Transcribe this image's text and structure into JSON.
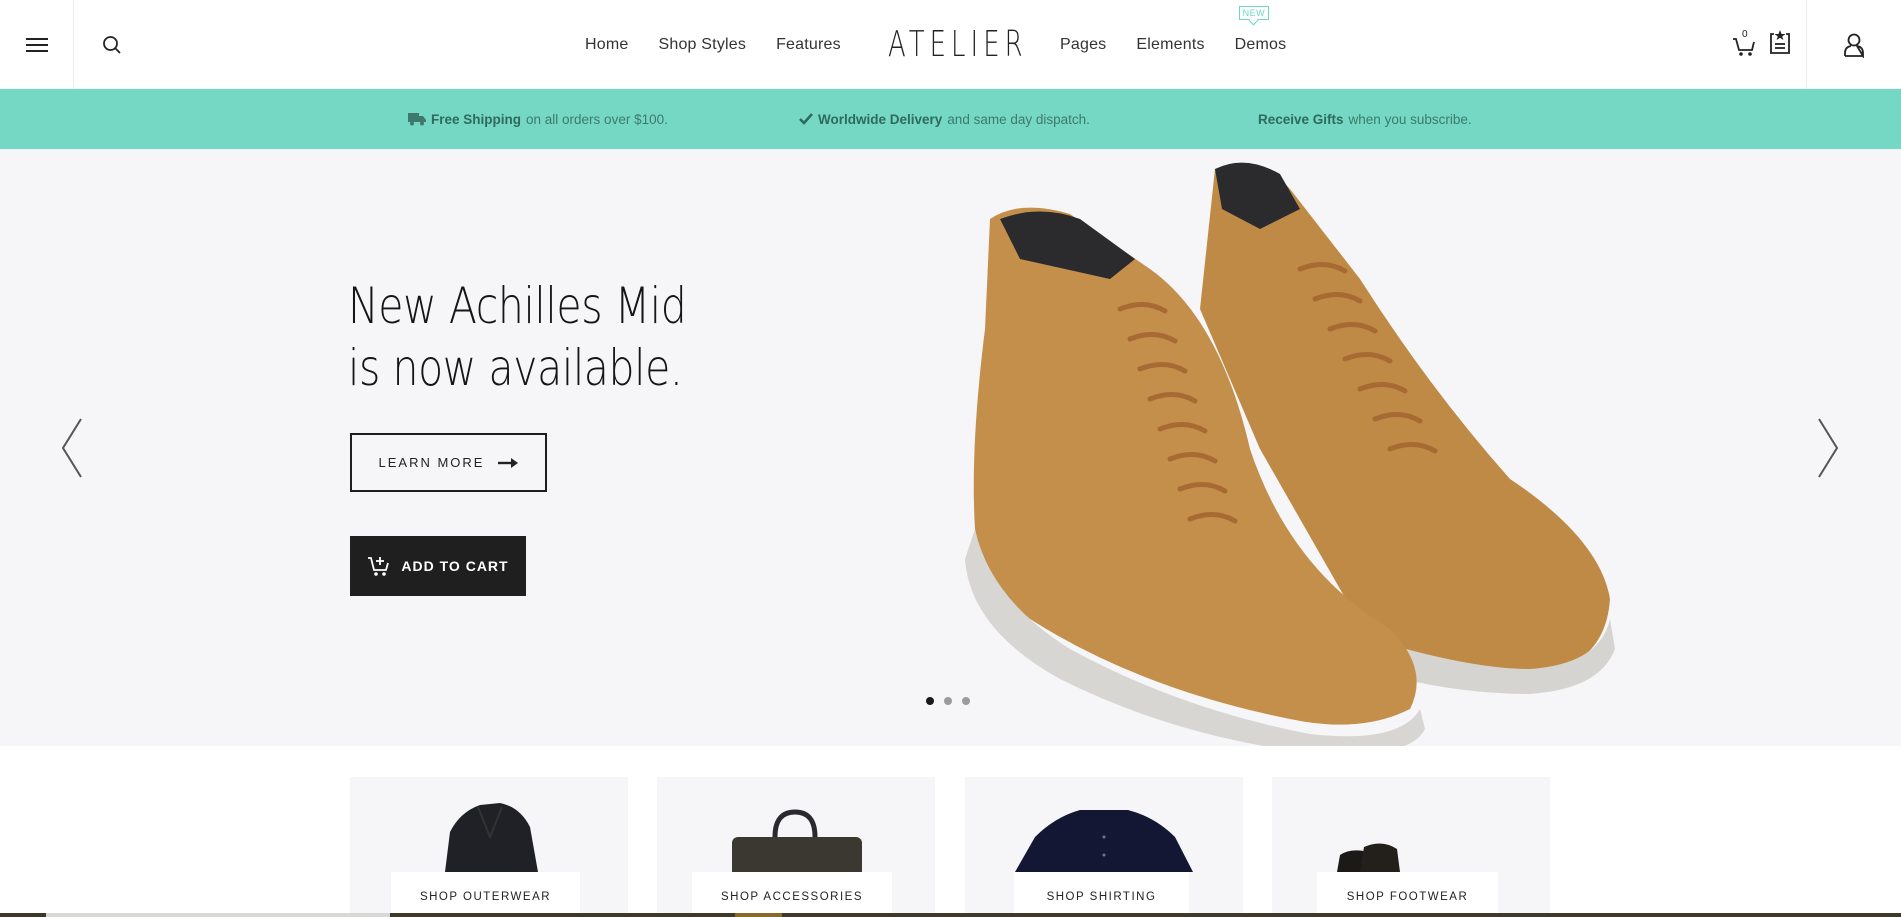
{
  "header": {
    "logo": "ATELIER",
    "nav_left": [
      {
        "label": "Home"
      },
      {
        "label": "Shop Styles"
      },
      {
        "label": "Features"
      }
    ],
    "nav_right": [
      {
        "label": "Pages"
      },
      {
        "label": "Elements"
      },
      {
        "label": "Demos",
        "badge": "NEW"
      }
    ],
    "cart_count": "0",
    "icons": [
      "menu-icon",
      "search-icon",
      "cart-icon",
      "wishlist-icon",
      "user-icon"
    ]
  },
  "promo": {
    "items": [
      {
        "icon": "truck-icon",
        "bold": "Free Shipping",
        "text": "on all orders over $100."
      },
      {
        "icon": "check-icon",
        "bold": "Worldwide Delivery",
        "text": "and same day dispatch."
      },
      {
        "icon": "",
        "bold": "Receive Gifts",
        "text": "when you subscribe."
      }
    ]
  },
  "hero": {
    "title_line1": "New Achilles Mid",
    "title_line2": "is now available.",
    "learn_more": "LEARN MORE",
    "add_to_cart": "ADD TO CART",
    "slides": 3,
    "active_slide": 1
  },
  "categories": [
    {
      "label": "SHOP OUTERWEAR"
    },
    {
      "label": "SHOP ACCESSORIES"
    },
    {
      "label": "SHOP SHIRTING"
    },
    {
      "label": "SHOP FOOTWEAR"
    }
  ],
  "colors": {
    "accent": "#74d8c4",
    "promo_text": "#3e7a6b",
    "button_dark": "#1f1f1f",
    "hero_bg": "#f6f6f8"
  }
}
